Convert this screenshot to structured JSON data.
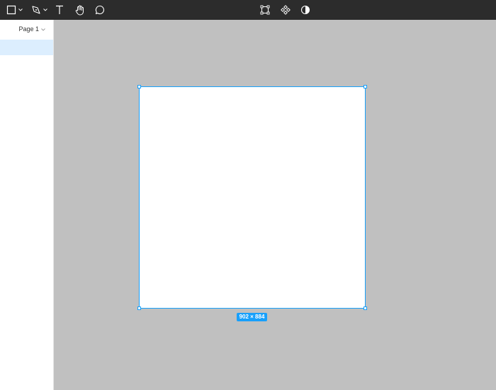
{
  "toolbar": {
    "left_tools": [
      {
        "name": "frame-tool",
        "icon": "square-icon",
        "has_dropdown": true
      },
      {
        "name": "pen-tool",
        "icon": "pen-icon",
        "has_dropdown": true
      },
      {
        "name": "text-tool",
        "icon": "text-icon",
        "label": "T"
      },
      {
        "name": "hand-tool",
        "icon": "hand-icon"
      },
      {
        "name": "comment-tool",
        "icon": "comment-icon"
      }
    ],
    "center_tools": [
      {
        "name": "edit-object",
        "icon": "frame-corners-icon"
      },
      {
        "name": "components",
        "icon": "component-icon"
      },
      {
        "name": "mask",
        "icon": "half-circle-icon"
      }
    ]
  },
  "sidebar": {
    "page_picker": {
      "label": "Page 1"
    }
  },
  "canvas": {
    "selection": {
      "size_label": "902 × 884"
    }
  },
  "colors": {
    "toolbar_bg": "#2c2c2c",
    "canvas_bg": "#c0c0c0",
    "selection_blue": "#18a0fb",
    "page_row_highlight": "#dceefe"
  }
}
